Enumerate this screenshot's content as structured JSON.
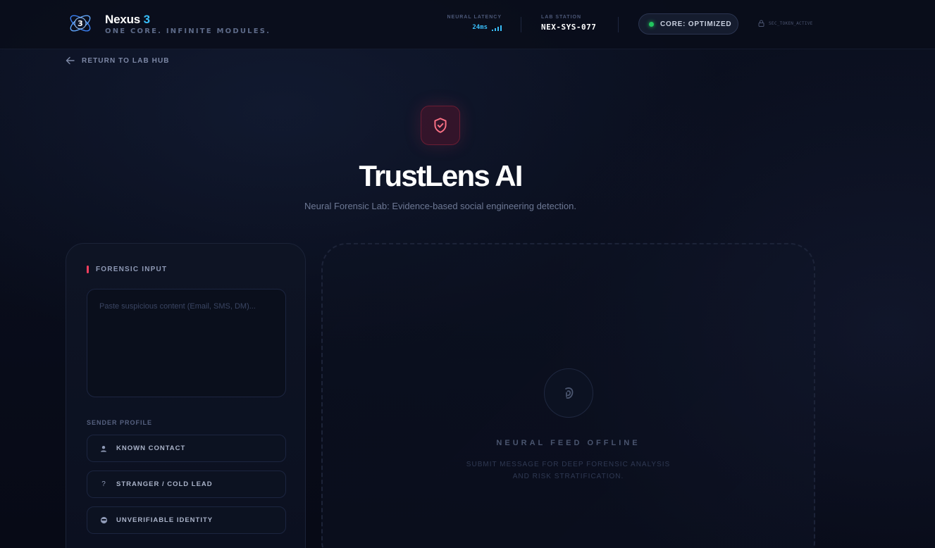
{
  "header": {
    "brand_name": "Nexus",
    "brand_version": "3",
    "brand_tagline": "ONE CORE. INFINITE MODULES.",
    "latency_label": "NEURAL LATENCY",
    "latency_value": "24ms",
    "station_label": "LAB STATION",
    "station_value": "NEX-SYS-077",
    "core_status": "CORE: OPTIMIZED",
    "sec_token": "SEC_TOKEN_ACTIVE"
  },
  "nav": {
    "return_label": "RETURN TO LAB HUB"
  },
  "hero": {
    "title": "TrustLens AI",
    "subtitle": "Neural Forensic Lab: Evidence-based social engineering detection."
  },
  "input_panel": {
    "title": "FORENSIC INPUT",
    "content_placeholder": "Paste suspicious content (Email, SMS, DM)...",
    "content_value": "",
    "sender_profile_label": "SENDER PROFILE",
    "sender_options": [
      {
        "label": "KNOWN CONTACT",
        "icon": "person-icon"
      },
      {
        "label": "STRANGER / COLD LEAD",
        "icon": "question-icon"
      },
      {
        "label": "UNVERIFIABLE IDENTITY",
        "icon": "masked-face-icon"
      }
    ]
  },
  "output_panel": {
    "status_title": "NEURAL FEED OFFLINE",
    "status_line_1": "SUBMIT MESSAGE FOR DEEP FORENSIC ANALYSIS",
    "status_line_2": "AND RISK STRATIFICATION."
  },
  "colors": {
    "accent_blue": "#38bdf8",
    "accent_red": "#f43f5e",
    "status_green": "#22c55e",
    "background": "#080c18"
  }
}
